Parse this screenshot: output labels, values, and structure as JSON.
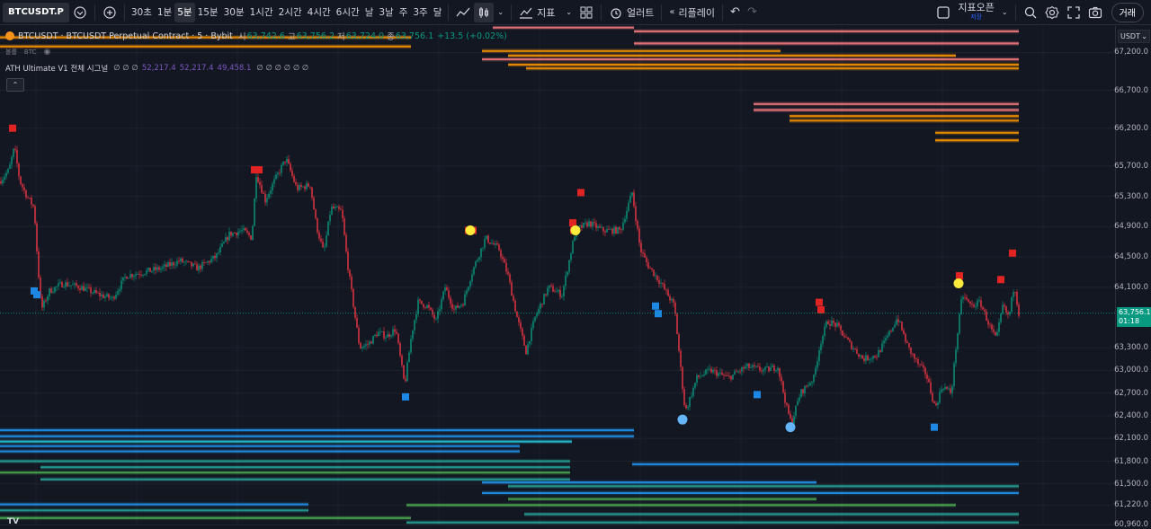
{
  "toolbar": {
    "symbol": "BTCUSDT.P",
    "intervals": [
      {
        "label": "30초",
        "active": false
      },
      {
        "label": "1분",
        "active": false
      },
      {
        "label": "5분",
        "active": true
      },
      {
        "label": "15분",
        "active": false
      },
      {
        "label": "30분",
        "active": false
      },
      {
        "label": "1시간",
        "active": false
      },
      {
        "label": "2시간",
        "active": false
      },
      {
        "label": "4시간",
        "active": false
      },
      {
        "label": "6시간",
        "active": false
      },
      {
        "label": "날",
        "active": false
      },
      {
        "label": "3날",
        "active": false
      },
      {
        "label": "주",
        "active": false
      },
      {
        "label": "3주",
        "active": false
      },
      {
        "label": "달",
        "active": false
      }
    ],
    "indicators_label": "지표",
    "alert_label": "얼러트",
    "replay_label": "리플레이",
    "publish_label": "지표오픈",
    "publish_sub": "저장",
    "trade_label": "거래"
  },
  "legend": {
    "title": "BTCUSDT · BTCUSDT Perpetual Contract · 5 · Bybit",
    "o_label": "시",
    "o_value": "63,742.6",
    "h_label": "고",
    "h_value": "63,756.2",
    "l_label": "저",
    "l_value": "63,724.0",
    "c_label": "종",
    "c_value": "63,756.1",
    "change": "+13.5 (+0.02%)",
    "row2_left": "볼륨",
    "row2_right": "BTC",
    "indicator_name": "ATH Ultimate V1 전체 시그널",
    "indicator_values": [
      "52,217.4",
      "52,217.4",
      "49,458.1"
    ]
  },
  "price_axis": {
    "currency": "USDT",
    "labels": [
      "67,200.0",
      "66,700.0",
      "66,200.0",
      "65,700.0",
      "65,300.0",
      "64,900.0",
      "64,500.0",
      "64,100.0",
      "63,300.0",
      "63,000.0",
      "62,700.0",
      "62,400.0",
      "62,100.0",
      "61,800.0",
      "61,500.0",
      "61,220.0",
      "60,960.0"
    ],
    "last_price": "63,756.1",
    "countdown": "01:18"
  },
  "chart_data": {
    "type": "candlestick",
    "price_range": [
      60940,
      67550
    ],
    "colors": {
      "up": "#089981",
      "down": "#f23645",
      "bg": "#131722"
    },
    "close_path": [
      [
        0,
        65500
      ],
      [
        10,
        65650
      ],
      [
        16,
        65950
      ],
      [
        22,
        65500
      ],
      [
        30,
        65300
      ],
      [
        38,
        65150
      ],
      [
        42,
        64400
      ],
      [
        46,
        63800
      ],
      [
        55,
        64050
      ],
      [
        70,
        64150
      ],
      [
        90,
        64100
      ],
      [
        110,
        64000
      ],
      [
        125,
        63950
      ],
      [
        140,
        64250
      ],
      [
        160,
        64300
      ],
      [
        180,
        64350
      ],
      [
        200,
        64450
      ],
      [
        220,
        64350
      ],
      [
        240,
        64500
      ],
      [
        255,
        64800
      ],
      [
        270,
        64850
      ],
      [
        280,
        64750
      ],
      [
        285,
        65600
      ],
      [
        295,
        65250
      ],
      [
        305,
        65500
      ],
      [
        318,
        65800
      ],
      [
        330,
        65400
      ],
      [
        345,
        65450
      ],
      [
        352,
        64900
      ],
      [
        360,
        64550
      ],
      [
        368,
        65150
      ],
      [
        380,
        65100
      ],
      [
        386,
        64450
      ],
      [
        395,
        63700
      ],
      [
        400,
        63300
      ],
      [
        410,
        63350
      ],
      [
        420,
        63500
      ],
      [
        430,
        63450
      ],
      [
        440,
        63550
      ],
      [
        450,
        62800
      ],
      [
        458,
        63500
      ],
      [
        465,
        63900
      ],
      [
        475,
        63850
      ],
      [
        485,
        63650
      ],
      [
        495,
        64100
      ],
      [
        505,
        63800
      ],
      [
        515,
        63900
      ],
      [
        525,
        64300
      ],
      [
        540,
        64750
      ],
      [
        555,
        64600
      ],
      [
        565,
        64250
      ],
      [
        575,
        63700
      ],
      [
        585,
        63250
      ],
      [
        595,
        63700
      ],
      [
        610,
        64100
      ],
      [
        625,
        64000
      ],
      [
        640,
        64850
      ],
      [
        655,
        64950
      ],
      [
        670,
        64850
      ],
      [
        690,
        64850
      ],
      [
        703,
        65350
      ],
      [
        712,
        64600
      ],
      [
        720,
        64400
      ],
      [
        735,
        64150
      ],
      [
        750,
        63850
      ],
      [
        758,
        62900
      ],
      [
        762,
        62450
      ],
      [
        775,
        62900
      ],
      [
        790,
        63000
      ],
      [
        810,
        62900
      ],
      [
        830,
        63050
      ],
      [
        850,
        63000
      ],
      [
        865,
        63050
      ],
      [
        875,
        62500
      ],
      [
        880,
        62300
      ],
      [
        890,
        62700
      ],
      [
        905,
        62900
      ],
      [
        912,
        63350
      ],
      [
        920,
        63650
      ],
      [
        930,
        63600
      ],
      [
        945,
        63350
      ],
      [
        960,
        63150
      ],
      [
        975,
        63200
      ],
      [
        985,
        63400
      ],
      [
        998,
        63700
      ],
      [
        1010,
        63300
      ],
      [
        1020,
        63100
      ],
      [
        1030,
        62950
      ],
      [
        1040,
        62500
      ],
      [
        1048,
        62800
      ],
      [
        1058,
        62700
      ],
      [
        1063,
        63300
      ],
      [
        1070,
        64000
      ],
      [
        1080,
        63850
      ],
      [
        1090,
        63900
      ],
      [
        1100,
        63600
      ],
      [
        1108,
        63400
      ],
      [
        1115,
        63850
      ],
      [
        1122,
        63700
      ],
      [
        1128,
        64150
      ],
      [
        1133,
        63756
      ]
    ],
    "sell_markers": [
      [
        14,
        66200
      ],
      [
        283,
        65650
      ],
      [
        288,
        65650
      ],
      [
        521,
        64850
      ],
      [
        526,
        64850
      ],
      [
        637,
        64950
      ],
      [
        638,
        64850
      ],
      [
        646,
        65350
      ],
      [
        911,
        63900
      ],
      [
        913,
        63800
      ],
      [
        1067,
        64250
      ],
      [
        1113,
        64200
      ],
      [
        1126,
        64550
      ]
    ],
    "buy_markers": [
      [
        38,
        64050
      ],
      [
        41,
        64000
      ],
      [
        451,
        62650
      ],
      [
        729,
        63850
      ],
      [
        732,
        63750
      ],
      [
        842,
        62680
      ],
      [
        1039,
        62250
      ]
    ],
    "circle_markers": [
      [
        523,
        64850,
        "#ffeb3b"
      ],
      [
        640,
        64850,
        "#ffeb3b"
      ],
      [
        759,
        62350,
        "#64b5f6"
      ],
      [
        879,
        62250,
        "#64b5f6"
      ],
      [
        1066,
        64150,
        "#ffeb3b"
      ]
    ],
    "resistance_lines": [
      [
        548,
        705,
        67600,
        "#f77c80"
      ],
      [
        548,
        705,
        67530,
        "#f77c80"
      ],
      [
        705,
        1133,
        67480,
        "#f77c80"
      ],
      [
        705,
        1133,
        67320,
        "#f77c80"
      ],
      [
        0,
        457,
        67400,
        "#ff9800"
      ],
      [
        0,
        457,
        67280,
        "#ff9800"
      ],
      [
        536,
        868,
        67220,
        "#ff9800"
      ],
      [
        565,
        1063,
        67160,
        "#ff9800"
      ],
      [
        536,
        1133,
        67110,
        "#f77c80"
      ],
      [
        565,
        1133,
        67040,
        "#ff9800"
      ],
      [
        585,
        1133,
        66990,
        "#ff9800"
      ],
      [
        838,
        1133,
        66520,
        "#f77c80"
      ],
      [
        838,
        1133,
        66440,
        "#f77c80"
      ],
      [
        878,
        1133,
        66360,
        "#ff9800"
      ],
      [
        878,
        1133,
        66300,
        "#ff9800"
      ],
      [
        1040,
        1133,
        66140,
        "#ff9800"
      ],
      [
        1040,
        1133,
        66040,
        "#ff9800"
      ]
    ],
    "support_lines": [
      [
        0,
        705,
        62210,
        "#2196f3"
      ],
      [
        0,
        705,
        62130,
        "#2196f3"
      ],
      [
        0,
        636,
        62060,
        "#26c6da"
      ],
      [
        0,
        578,
        62000,
        "#2196f3"
      ],
      [
        0,
        578,
        61930,
        "#2196f3"
      ],
      [
        0,
        634,
        61800,
        "#26a69a"
      ],
      [
        45,
        634,
        61720,
        "#26a69a"
      ],
      [
        0,
        634,
        61650,
        "#4caf50"
      ],
      [
        45,
        634,
        61560,
        "#26a69a"
      ],
      [
        703,
        1133,
        61760,
        "#2196f3"
      ],
      [
        536,
        908,
        61520,
        "#2196f3"
      ],
      [
        565,
        1133,
        61470,
        "#26a69a"
      ],
      [
        536,
        1133,
        61380,
        "#2196f3"
      ],
      [
        565,
        908,
        61300,
        "#4caf50"
      ],
      [
        452,
        1063,
        61220,
        "#4caf50"
      ],
      [
        0,
        343,
        61230,
        "#2196f3"
      ],
      [
        0,
        343,
        61150,
        "#26a69a"
      ],
      [
        583,
        1133,
        61100,
        "#26a69a"
      ],
      [
        0,
        457,
        61050,
        "#4caf50"
      ],
      [
        452,
        1133,
        60990,
        "#26a69a"
      ]
    ]
  }
}
